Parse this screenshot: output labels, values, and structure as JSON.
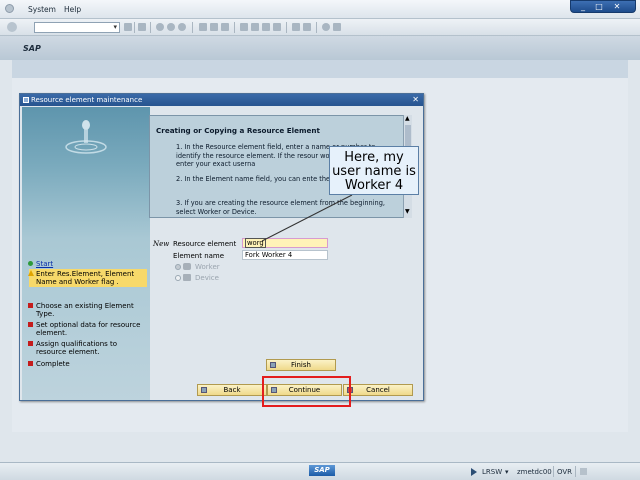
{
  "menu": {
    "system": "System",
    "help": "Help"
  },
  "window_controls": {
    "minimize": "_",
    "maximize": "□",
    "close": "✕"
  },
  "toolbar": {
    "command_field_value": "",
    "dropdown_glyph": "▾"
  },
  "app": {
    "title": "SAP"
  },
  "dialog": {
    "title": "Resource element maintenance",
    "close": "✕",
    "steps": [
      {
        "label": "Start",
        "status": "done"
      },
      {
        "label": "Enter Res.Element, Element Name and Worker flag .",
        "status": "current"
      },
      {
        "label": "Choose an existing Element Type.",
        "status": "todo"
      },
      {
        "label": "Set optional data for resource element.",
        "status": "todo"
      },
      {
        "label": "Assign qualifications to resource element.",
        "status": "todo"
      },
      {
        "label": "Complete",
        "status": "todo"
      }
    ],
    "help": {
      "heading": "Creating or Copying a Resource Element",
      "p1": "1. In the Resource element field, enter a name or number to identify the resource element. If the resour worker, you must enter your exact userna",
      "p2": "2. In the Element name field, you can ente the resource element.",
      "p3": "3. If you are creating the resource element from the beginning, select Worker or Device."
    },
    "callout": "Here, my user name is Worker 4",
    "form": {
      "new_label": "New",
      "resource_element_label": "Resource element",
      "resource_element_value": "worg",
      "element_name_label": "Element name",
      "element_name_value": "Fork Worker 4",
      "worker_label": "Worker",
      "device_label": "Device"
    },
    "buttons": {
      "finish": "Finish",
      "back": "Back",
      "continue": "Continue",
      "cancel": "Cancel"
    }
  },
  "status": {
    "brand": "SAP",
    "transaction": "LRSW",
    "server": "zmetdc00",
    "mode": "OVR"
  },
  "colors": {
    "highlight": "#e31d1d",
    "title_bar": "#27548f",
    "current_step": "#f7d96a"
  }
}
